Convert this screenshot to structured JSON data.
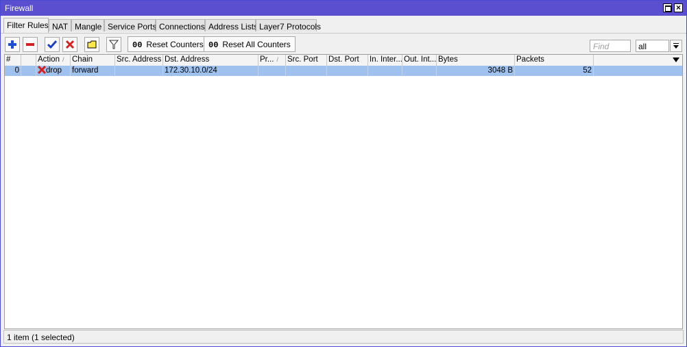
{
  "window": {
    "title": "Firewall"
  },
  "tabs": [
    "Filter Rules",
    "NAT",
    "Mangle",
    "Service Ports",
    "Connections",
    "Address Lists",
    "Layer7 Protocols"
  ],
  "toolbar": {
    "reset_counters_label": "Reset Counters",
    "reset_all_counters_label": "Reset All Counters",
    "counter_prefix": "00",
    "find_placeholder": "Find",
    "filter_value": "all"
  },
  "table": {
    "headers": [
      "#",
      "",
      "Action",
      "Chain",
      "Src. Address",
      "Dst. Address",
      "Pr...",
      "Src. Port",
      "Dst. Port",
      "In. Inter...",
      "Out. Int...",
      "Bytes",
      "Packets"
    ],
    "rows": [
      {
        "num": "0",
        "flag": "",
        "action": "drop",
        "chain": "forward",
        "src_address": "",
        "dst_address": "172.30.10.0/24",
        "protocol": "",
        "src_port": "",
        "dst_port": "",
        "in_interface": "",
        "out_interface": "",
        "bytes": "3048 B",
        "packets": "52",
        "selected": true
      }
    ]
  },
  "status": {
    "text": "1 item (1 selected)"
  },
  "colors": {
    "titlebar": "#5a4fcf",
    "selected_row": "#9fc1ee",
    "add": "#1a4fd6",
    "remove": "#d42020"
  },
  "icons": [
    "add-icon",
    "remove-icon",
    "enable-icon",
    "disable-icon",
    "comment-icon",
    "filter-icon",
    "drop-action-icon",
    "column-menu-icon"
  ]
}
